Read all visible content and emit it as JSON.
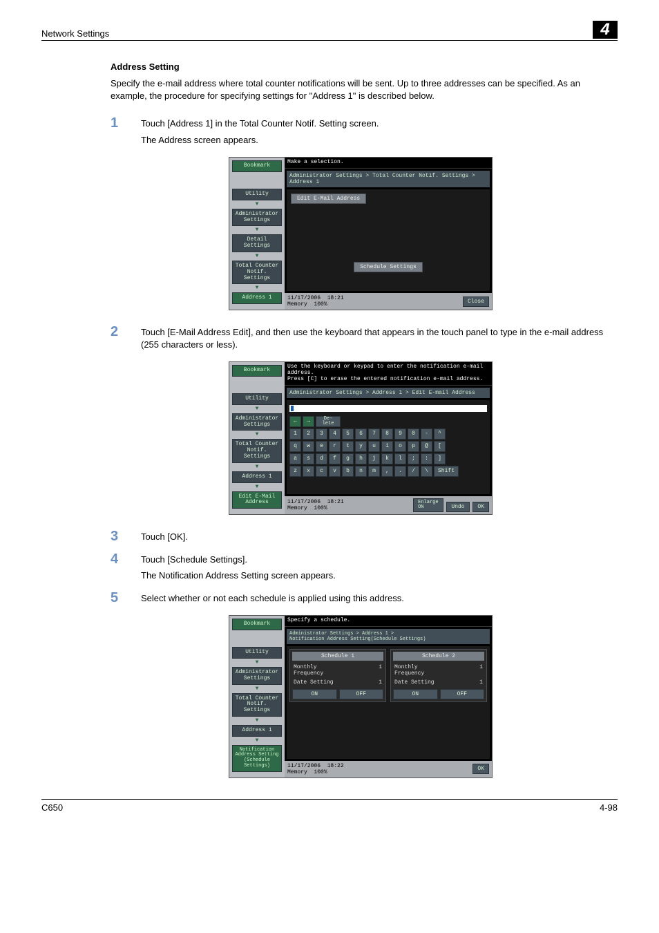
{
  "header": {
    "left": "Network Settings",
    "right": "4"
  },
  "section": {
    "title": "Address Setting",
    "intro": "Specify the e-mail address where total counter notifications will be sent. Up to three addresses can be specified. As an example, the procedure for specifying settings for \"Address 1\" is described below."
  },
  "steps": {
    "s1": {
      "num": "1",
      "line1": "Touch [Address 1] in the Total Counter Notif. Setting screen.",
      "line2": "The Address screen appears."
    },
    "s2": {
      "num": "2",
      "line1": "Touch [E-Mail Address Edit], and then use the keyboard that appears in the touch panel to type in the e-mail address (255 characters or less)."
    },
    "s3": {
      "num": "3",
      "line1": "Touch [OK]."
    },
    "s4": {
      "num": "4",
      "line1": "Touch [Schedule Settings].",
      "line2": "The Notification Address Setting screen appears."
    },
    "s5": {
      "num": "5",
      "line1": "Select whether or not each schedule is applied using this address."
    }
  },
  "screen1": {
    "top": "Make a selection.",
    "crumb": "Administrator Settings > Total Counter Notif. Settings > Address 1",
    "side": {
      "bookmark": "Bookmark",
      "utility": "Utility",
      "admin": "Administrator\nSettings",
      "detail": "Detail\nSettings",
      "tcnotif": "Total Counter\nNotif. Settings",
      "addr1": "Address 1"
    },
    "editEmail": "Edit E-Mail Address",
    "schedule": "Schedule Settings",
    "close": "Close",
    "date": "11/17/2006",
    "time": "18:21",
    "memory": "Memory",
    "memoryPct": "100%"
  },
  "screen2": {
    "top1": "Use the keyboard or keypad to enter the notification e-mail address.",
    "top2": "Press [C] to erase the entered notification e-mail address.",
    "crumb": "Administrator Settings > Address 1 > Edit E-mail Address",
    "side": {
      "bookmark": "Bookmark",
      "utility": "Utility",
      "admin": "Administrator\nSettings",
      "tcnotif": "Total Counter\nNotif. Settings",
      "addr1": "Address 1",
      "editemail": "Edit E-Mail\nAddress"
    },
    "delete": "De-\nlete",
    "keys": {
      "r1": [
        "1",
        "2",
        "3",
        "4",
        "5",
        "6",
        "7",
        "8",
        "9",
        "0",
        "-",
        "^"
      ],
      "r2": [
        "q",
        "w",
        "e",
        "r",
        "t",
        "y",
        "u",
        "i",
        "o",
        "p",
        "@",
        "["
      ],
      "r3": [
        "a",
        "s",
        "d",
        "f",
        "g",
        "h",
        "j",
        "k",
        "l",
        ";",
        ":",
        "]"
      ],
      "r4": [
        "z",
        "x",
        "c",
        "v",
        "b",
        "n",
        "m",
        ",",
        ".",
        "/",
        "\\"
      ]
    },
    "shift": "Shift",
    "enlarge": "Enlarge\nON",
    "undo": "Undo",
    "ok": "OK",
    "date": "11/17/2006",
    "time": "18:21",
    "memory": "Memory",
    "memoryPct": "100%"
  },
  "screen3": {
    "top": "Specify a schedule.",
    "crumb": "Administrator Settings > Address 1 >\nNotification Address Setting(Schedule Settings)",
    "side": {
      "bookmark": "Bookmark",
      "utility": "Utility",
      "admin": "Administrator\nSettings",
      "tcnotif": "Total Counter\nNotif. Settings",
      "addr1": "Address 1",
      "notif": "Notification\nAddress Setting\n(Schedule\nSettings)"
    },
    "col1": {
      "head": "Schedule 1",
      "monthly": "Monthly\nFrequency",
      "monthlyVal": "1",
      "dateSet": "Date Setting",
      "dateVal": "1",
      "on": "ON",
      "off": "OFF"
    },
    "col2": {
      "head": "Schedule 2",
      "monthly": "Monthly\nFrequency",
      "monthlyVal": "1",
      "dateSet": "Date Setting",
      "dateVal": "1",
      "on": "ON",
      "off": "OFF"
    },
    "ok": "OK",
    "date": "11/17/2006",
    "time": "18:22",
    "memory": "Memory",
    "memoryPct": "100%"
  },
  "footer": {
    "left": "C650",
    "right": "4-98"
  }
}
